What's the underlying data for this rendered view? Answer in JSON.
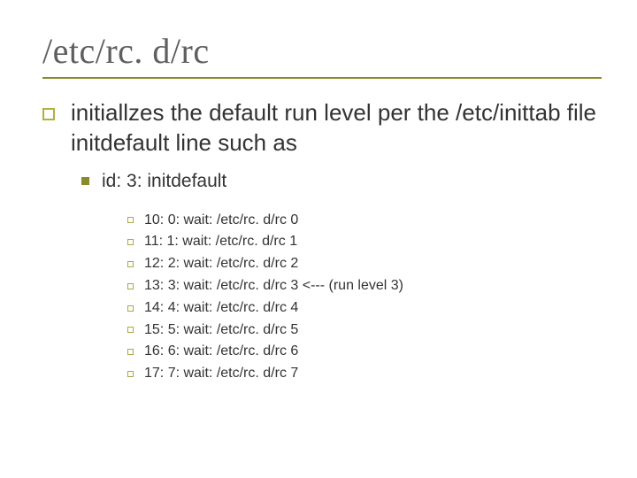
{
  "title": "/etc/rc. d/rc",
  "level1_text": "initiallzes the default run level per the /etc/inittab file initdefault line such as",
  "level2_text": "id: 3: initdefault",
  "lines": [
    "10: 0: wait: /etc/rc. d/rc 0",
    "11: 1: wait: /etc/rc. d/rc 1",
    "12: 2: wait: /etc/rc. d/rc 2",
    "13: 3: wait: /etc/rc. d/rc 3 <--- (run level 3)",
    "14: 4: wait: /etc/rc. d/rc 4",
    "15: 5: wait: /etc/rc. d/rc 5",
    "16: 6: wait: /etc/rc. d/rc 6",
    "17: 7: wait: /etc/rc. d/rc 7"
  ]
}
